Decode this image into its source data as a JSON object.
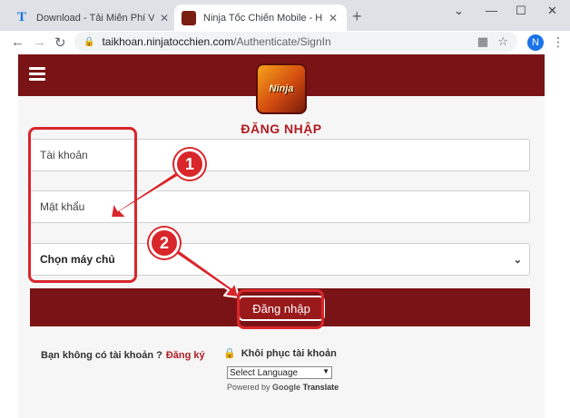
{
  "browser": {
    "tabs": [
      {
        "title": "Download - Tải Miễn Phí VN - Ph",
        "favicon": "T",
        "active": false
      },
      {
        "title": "Ninja Tốc Chiến Mobile - Huyền",
        "active": true
      }
    ],
    "url_host": "taikhoan.ninjatocchien.com",
    "url_path": "/Authenticate/SignIn",
    "profile_initial": "N"
  },
  "site": {
    "logo_text": "Ninja",
    "title": "ĐĂNG NHẬP",
    "fields": {
      "username_placeholder": "Tài khoản",
      "password_placeholder": "Mật khẩu",
      "server_label": "Chọn máy chủ"
    },
    "login_button": "Đăng nhập",
    "no_account_text": "Bạn không có tài khoản ?",
    "register_link": "Đăng ký",
    "recover_link": "Khôi phục tài khoản",
    "language_select": "Select Language",
    "powered_by": "Powered by",
    "google": "Google",
    "translate": "Translate"
  },
  "annotations": {
    "step1": "1",
    "step2": "2",
    "color": "#d9262b"
  }
}
